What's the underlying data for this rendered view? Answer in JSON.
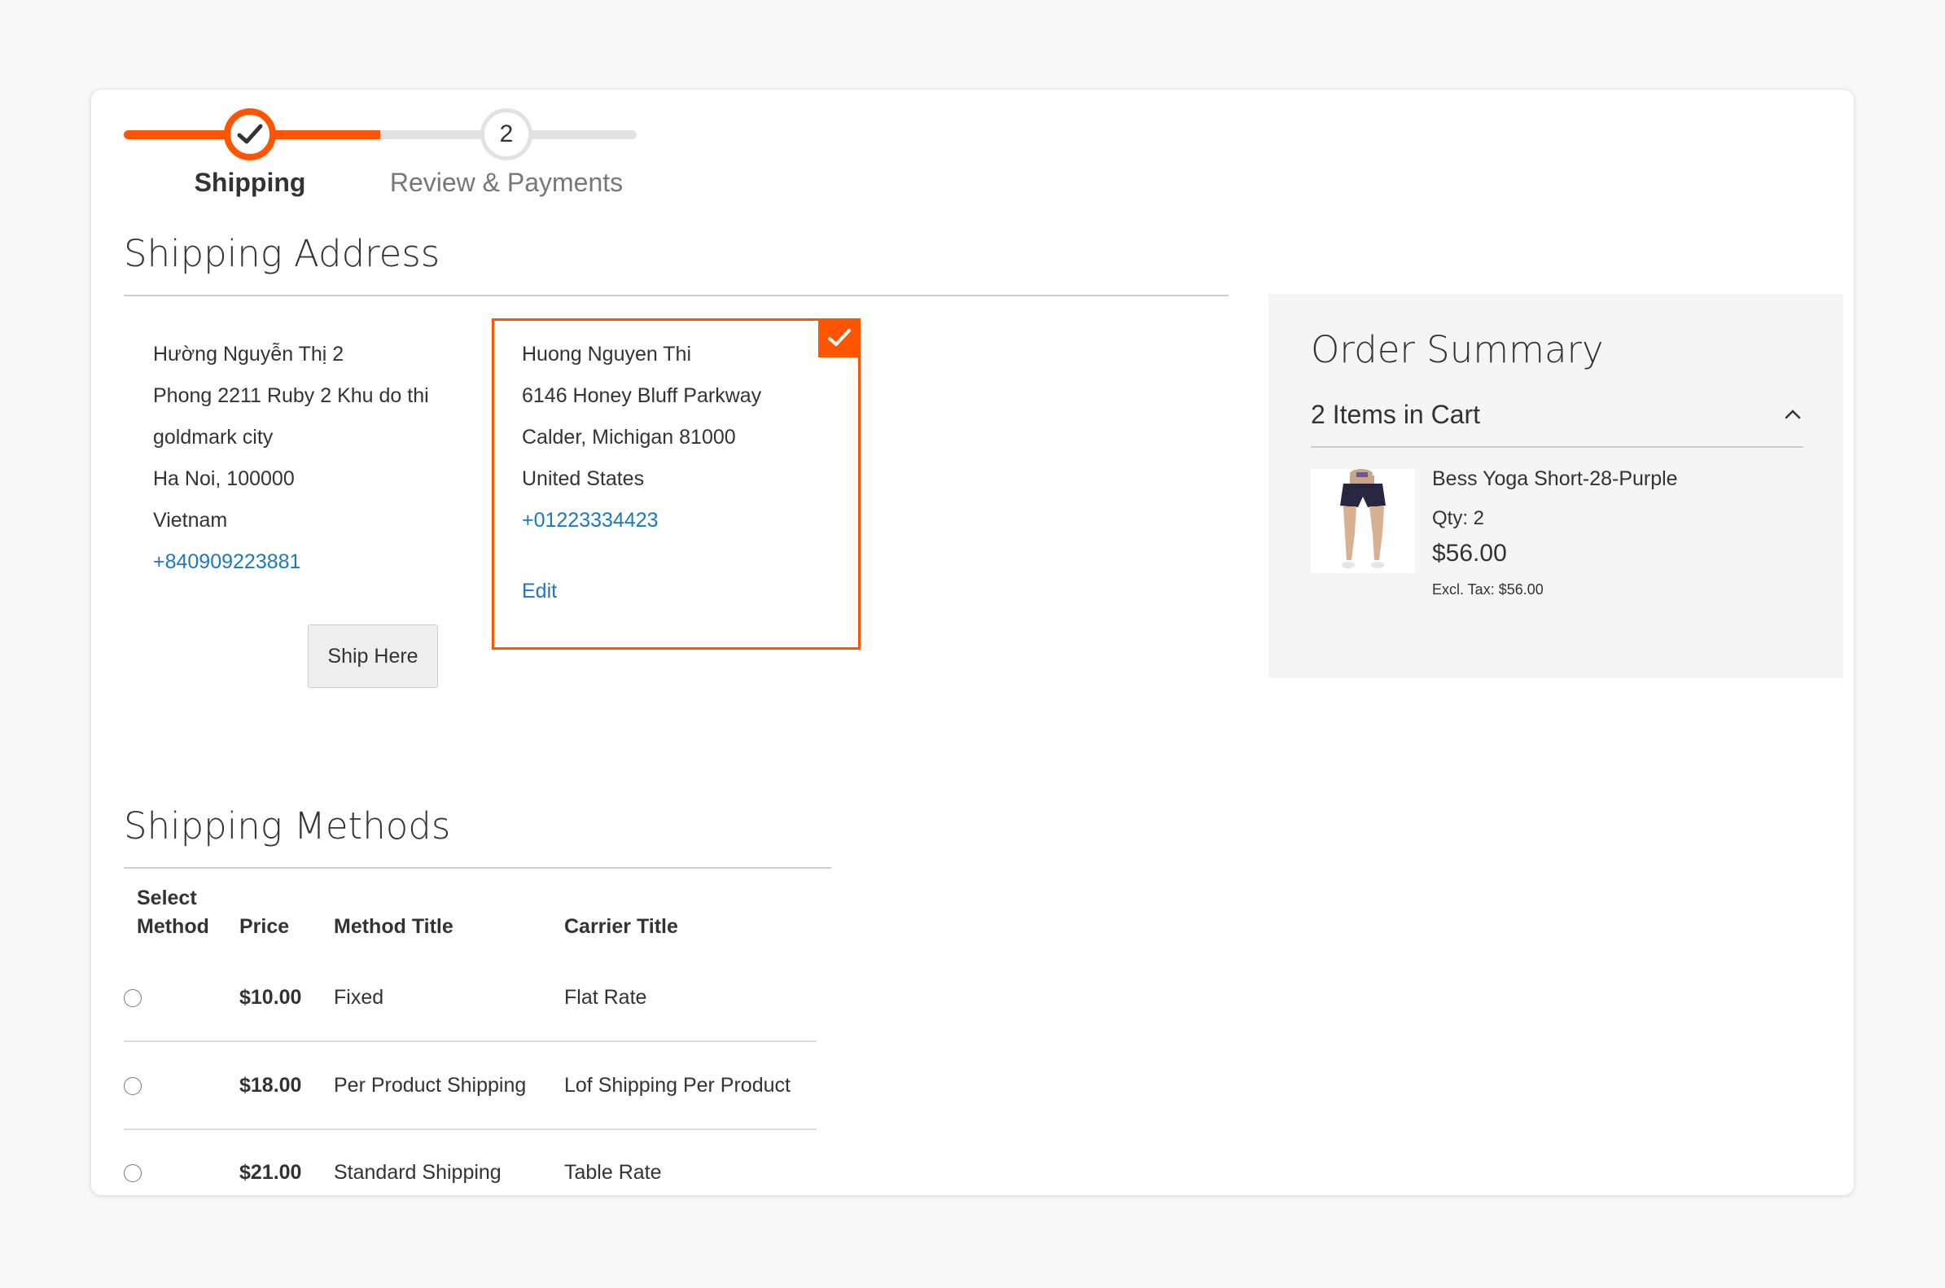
{
  "steps": [
    {
      "label": "Shipping",
      "state": "complete"
    },
    {
      "label": "Review & Payments",
      "number": "2",
      "state": "upcoming"
    }
  ],
  "progress_fraction": 0.5,
  "shipping_address": {
    "title": "Shipping Address",
    "addresses": [
      {
        "name": "Hường Nguyễn Thị 2",
        "street": "Phong 2211 Ruby 2 Khu do thi",
        "city_line": "goldmark city",
        "region_line": "Ha Noi, 100000",
        "country": "Vietnam",
        "phone": "+840909223881",
        "action_label": "Ship Here",
        "selected": false
      },
      {
        "name": "Huong Nguyen Thi",
        "street": "6146 Honey Bluff Parkway",
        "region_line": "Calder, Michigan 81000",
        "country": "United States",
        "phone": "+01223334423",
        "action_label": "Edit",
        "selected": true
      }
    ]
  },
  "shipping_methods": {
    "title": "Shipping Methods",
    "headers": {
      "select_line1": "Select",
      "select_line2": "Method",
      "price": "Price",
      "method_title": "Method Title",
      "carrier_title": "Carrier Title"
    },
    "rows": [
      {
        "price": "$10.00",
        "method": "Fixed",
        "carrier": "Flat Rate"
      },
      {
        "price": "$18.00",
        "method": "Per Product Shipping",
        "carrier": "Lof Shipping Per Product"
      },
      {
        "price": "$21.00",
        "method": "Standard Shipping",
        "carrier": "Table Rate"
      }
    ]
  },
  "order_summary": {
    "title": "Order Summary",
    "items_in_cart": "2 Items in Cart",
    "items": [
      {
        "name": "Bess Yoga Short-28-Purple",
        "qty": "Qty: 2",
        "price": "$56.00",
        "excl_tax": "Excl. Tax: $56.00"
      }
    ]
  },
  "colors": {
    "accent": "#ff5501",
    "link": "#1979c3",
    "track": "#e2e2e2"
  }
}
